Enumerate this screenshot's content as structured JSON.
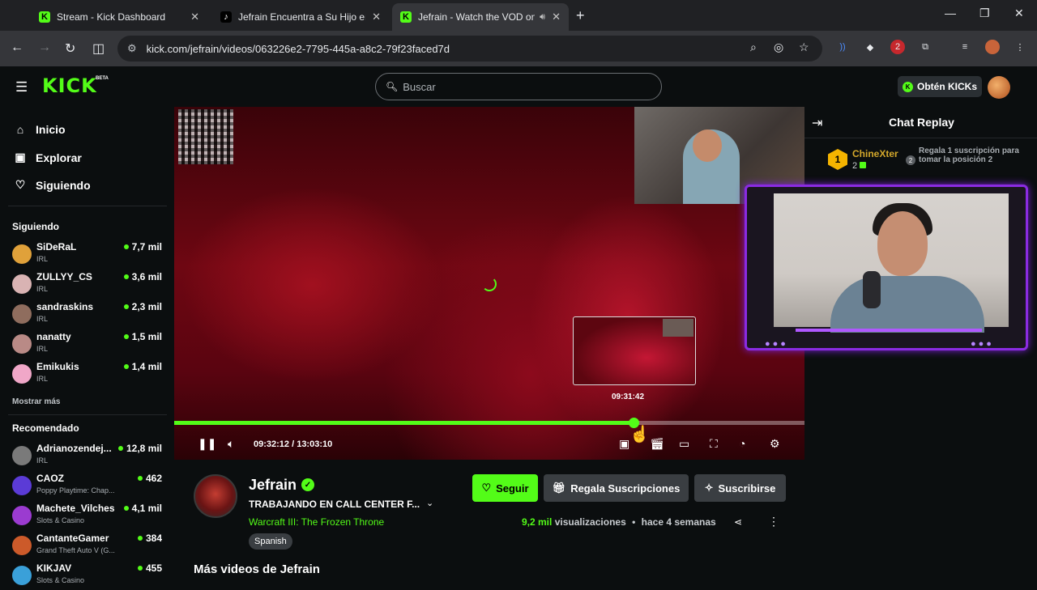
{
  "browser": {
    "tabs": [
      {
        "title": "Stream - Kick Dashboard",
        "favicon": "kick-icon"
      },
      {
        "title": "Jefrain Encuentra a Su Hijo en P",
        "favicon": "tiktok-icon"
      },
      {
        "title": "Jefrain - Watch the VOD on",
        "favicon": "kick-icon"
      }
    ],
    "url": "kick.com/jefrain/videos/063226e2-7795-445a-a8c2-79f23faced7d",
    "extension_badge": "2"
  },
  "header": {
    "logo": "KICK",
    "beta": "BETA",
    "search_placeholder": "Buscar",
    "kicks_button": "Obtén KICKs"
  },
  "sidebar": {
    "nav": [
      {
        "label": "Inicio",
        "icon": "home-icon"
      },
      {
        "label": "Explorar",
        "icon": "compass-icon"
      },
      {
        "label": "Siguiendo",
        "icon": "heart-icon"
      }
    ],
    "following_header": "Siguiendo",
    "following": [
      {
        "name": "SiDeRaL",
        "category": "IRL",
        "viewers": "7,7 mil",
        "color": "#e0a13a"
      },
      {
        "name": "ZULLYY_CS",
        "category": "IRL",
        "viewers": "3,6 mil",
        "color": "#d9b3b3"
      },
      {
        "name": "sandraskins",
        "category": "IRL",
        "viewers": "2,3 mil",
        "color": "#8f6d5e"
      },
      {
        "name": "nanatty",
        "category": "IRL",
        "viewers": "1,5 mil",
        "color": "#b98a86"
      },
      {
        "name": "Emikukis",
        "category": "IRL",
        "viewers": "1,4 mil",
        "color": "#f0a7c8"
      }
    ],
    "show_more": "Mostrar más",
    "recommended_header": "Recomendado",
    "recommended": [
      {
        "name": "Adrianozendej...",
        "category": "IRL",
        "viewers": "12,8 mil",
        "color": "#7a7a7a"
      },
      {
        "name": "CAOZ",
        "category": "Poppy Playtime: Chap...",
        "viewers": "462",
        "color": "#5b3bd6"
      },
      {
        "name": "Machete_Vilches",
        "category": "Slots & Casino",
        "viewers": "4,1 mil",
        "color": "#9b3bd0"
      },
      {
        "name": "CantanteGamer",
        "category": "Grand Theft Auto V (G...",
        "viewers": "384",
        "color": "#cc5a2a"
      },
      {
        "name": "KIKJAV",
        "category": "Slots & Casino",
        "viewers": "455",
        "color": "#3aa0d9"
      }
    ]
  },
  "player": {
    "hover_time": "09:31:42",
    "current_time": "09:32:12",
    "duration": "13:03:10",
    "time_display": "09:32:12 / 13:03:10",
    "progress_fraction": 0.729
  },
  "chat": {
    "title": "Chat Replay",
    "top_sub": {
      "rank": "1",
      "name": "ChineXter",
      "count": "2",
      "cta_rank": "2",
      "cta": "Regala 1 suscripción para tomar la posición 2"
    }
  },
  "channel": {
    "name": "Jefrain",
    "stream_title": "TRABAJANDO EN CALL CENTER F...",
    "game": "Warcraft III: The Frozen Throne",
    "language": "Spanish",
    "follow": "Seguir",
    "gift": "Regala Suscripciones",
    "subscribe": "Suscribirse",
    "views_num": "9,2 mil",
    "views_label": "visualizaciones",
    "separator": "•",
    "ago": "hace 4 semanas",
    "more_videos": "Más videos de Jefrain"
  },
  "colors": {
    "accent": "#53fc18",
    "purple": "#8a2be2",
    "gold": "#d4a82b"
  }
}
